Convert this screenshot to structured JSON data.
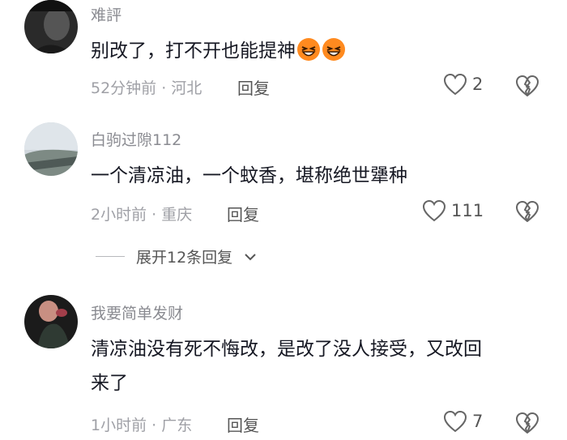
{
  "comments": [
    {
      "username": "难評",
      "text": "别改了，打不开也能提神",
      "emojis": [
        "laughing-face-emoji",
        "laughing-face-emoji"
      ],
      "time_location": "52分钟前 · 河北",
      "reply_label": "回复",
      "likes": "2"
    },
    {
      "username": "白驹过隙112",
      "text": "一个清凉油，一个蚊香，堪称绝世犟种",
      "time_location": "2小时前 · 重庆",
      "reply_label": "回复",
      "likes": "111",
      "expand_label": "展开12条回复"
    },
    {
      "username": "我要简单发财",
      "text_line1": "清凉油没有死不悔改，是改了没人接受，又改回",
      "text_line2": "来了",
      "time_location": "1小时前 · 广东",
      "reply_label": "回复",
      "likes": "7"
    }
  ],
  "colors": {
    "username": "#8a8b91",
    "text": "#161823",
    "meta": "#9fa0a6",
    "emoji": "#ff8a1f"
  }
}
